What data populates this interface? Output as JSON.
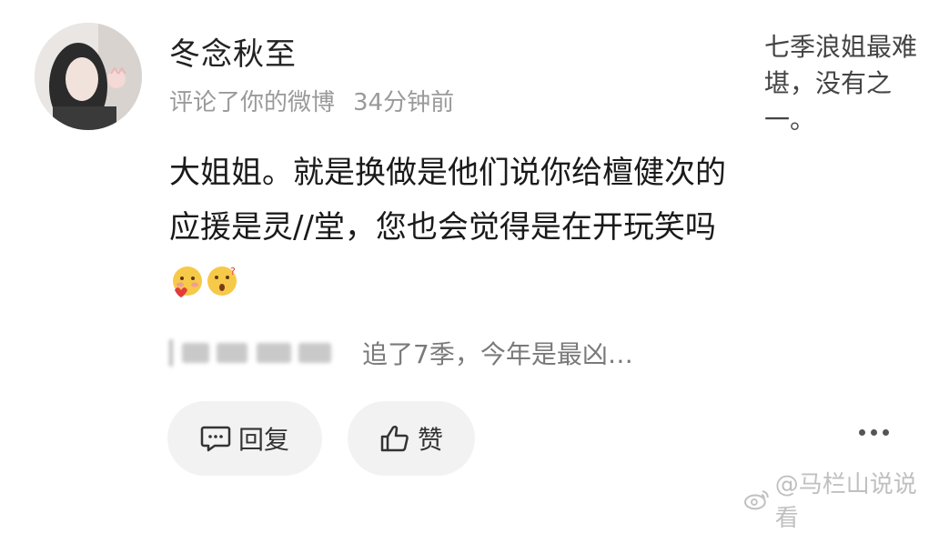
{
  "comment": {
    "username": "冬念秋至",
    "action": "评论了你的微博",
    "time": "34分钟前",
    "text": "大姐姐。就是换做是他们说你给檀健次的应援是灵//堂，您也会觉得是在开玩笑吗",
    "emojis": [
      "blushing-heart-emoji",
      "surprised-question-emoji"
    ]
  },
  "reply_preview": {
    "text": "追了7季，今年是最凶…"
  },
  "quoted_post": {
    "text": "七季浪姐最难堪，没有之一。"
  },
  "actions": {
    "reply_label": "回复",
    "like_label": "赞"
  },
  "watermark": {
    "text": "@马栏山说说看"
  }
}
